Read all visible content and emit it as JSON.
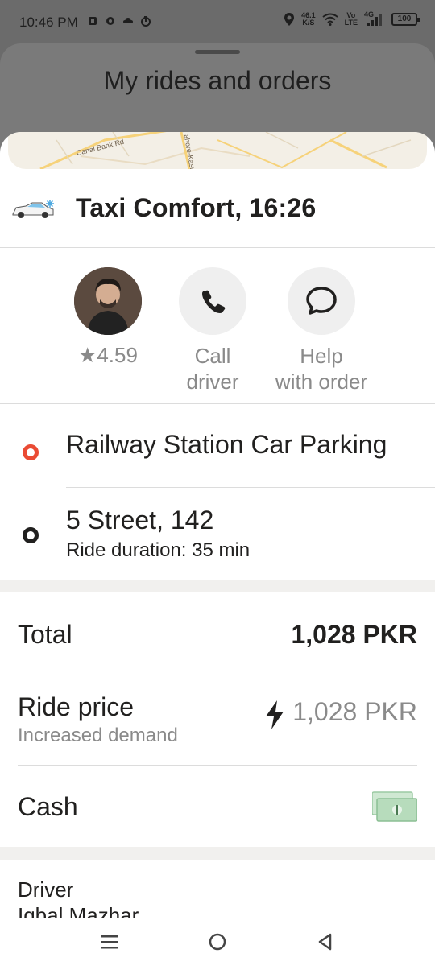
{
  "status_bar": {
    "time": "10:46 PM",
    "net_speed_value": "46.1",
    "net_speed_unit": "K/S",
    "volte_top": "Vo",
    "volte_bottom": "LTE",
    "network_type": "4G",
    "battery": "100"
  },
  "background": {
    "title": "My rides and orders"
  },
  "map": {
    "road_label_1": "Canal Bank Rd",
    "road_label_2": "Lahore-Kasur"
  },
  "ride": {
    "title": "Taxi Comfort, 16:26",
    "car_icon": "car-snowflake-icon"
  },
  "actions": {
    "rating": "★4.59",
    "call_label_1": "Call",
    "call_label_2": "driver",
    "help_label_1": "Help",
    "help_label_2": "with order"
  },
  "route": {
    "from": "Railway Station Car Parking",
    "to": "5 Street, 142",
    "duration": "Ride duration: 35 min"
  },
  "pricing": {
    "total_label": "Total",
    "total_value": "1,028 PKR",
    "ride_price_label": "Ride price",
    "ride_price_sub": "Increased demand",
    "ride_price_value": "1,028 PKR",
    "payment_label": "Cash"
  },
  "driver": {
    "label": "Driver",
    "name": "Iqbal Mazhar"
  },
  "colors": {
    "from_dot": "#ea4b34",
    "text_primary": "#21201f",
    "text_secondary": "#8a8a8a"
  }
}
